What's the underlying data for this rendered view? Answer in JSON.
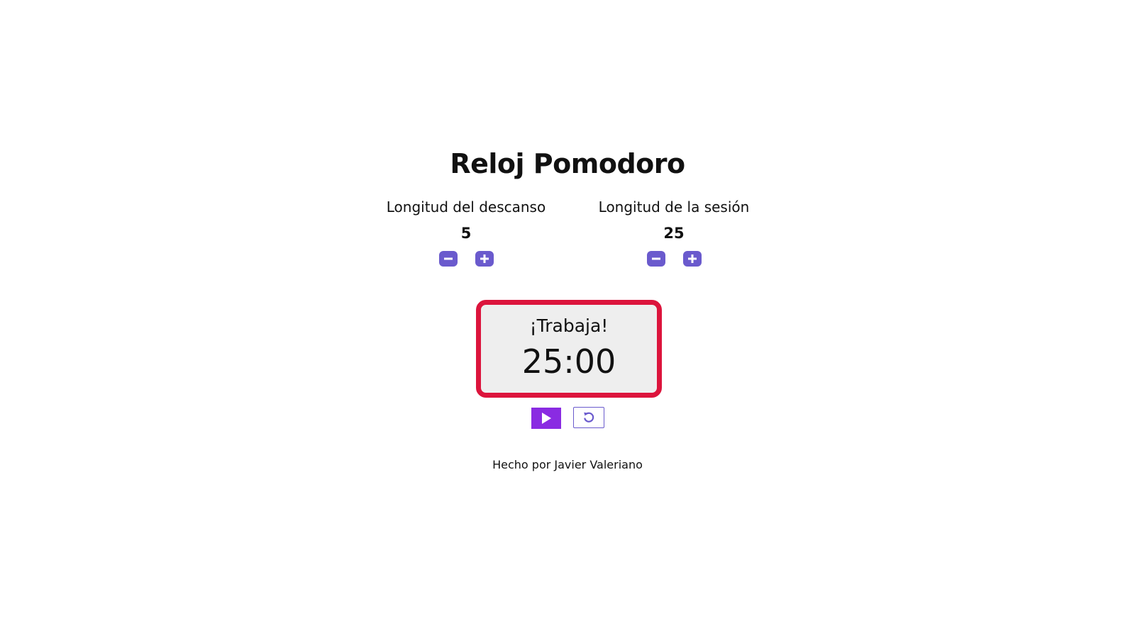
{
  "title": "Reloj Pomodoro",
  "break_setting": {
    "label": "Longitud del descanso",
    "value": "5"
  },
  "session_setting": {
    "label": "Longitud de la sesión",
    "value": "25"
  },
  "timer": {
    "label": "¡Trabaja!",
    "time": "25:00"
  },
  "icons": {
    "decrement": "minus-icon",
    "increment": "plus-icon",
    "start": "play-icon",
    "reset": "reset-icon"
  },
  "colors": {
    "accent": "#6a5acd",
    "play": "#8a2be2",
    "timer_border": "#dc143c",
    "timer_bg": "#eeeeee"
  },
  "footer": "Hecho por Javier Valeriano"
}
